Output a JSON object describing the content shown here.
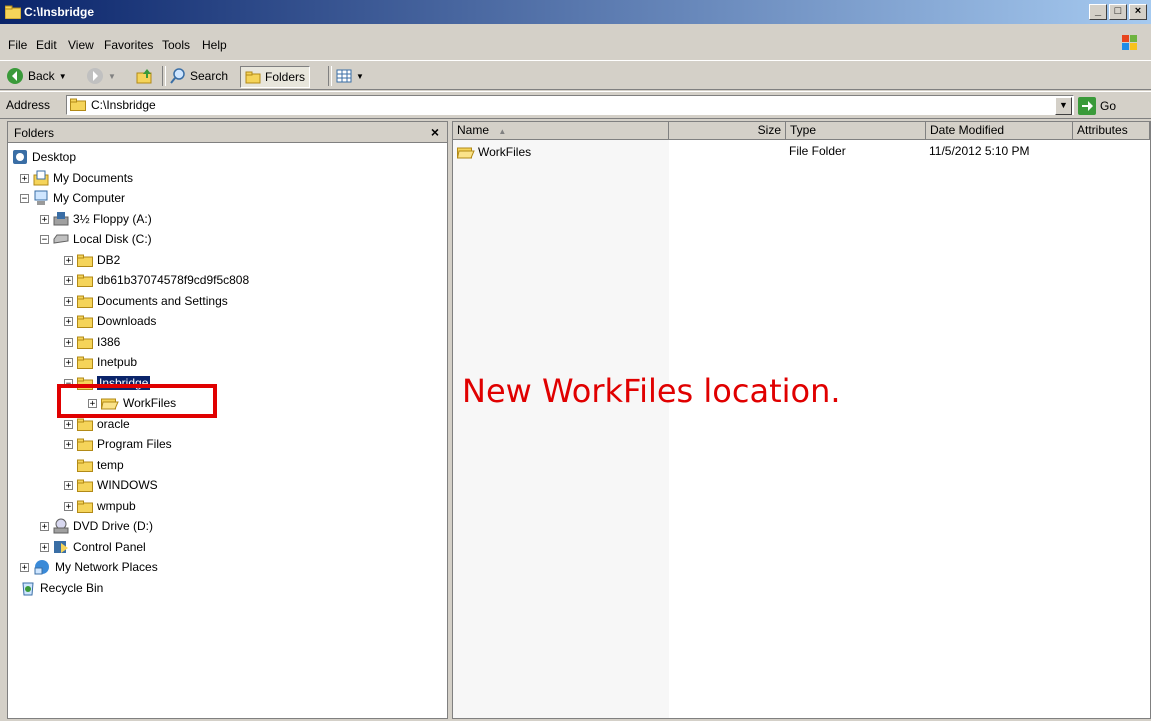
{
  "window": {
    "title": "C:\\Insbridge"
  },
  "menu": [
    {
      "label": "File"
    },
    {
      "label": "Edit"
    },
    {
      "label": "View"
    },
    {
      "label": "Favorites"
    },
    {
      "label": "Tools"
    },
    {
      "label": "Help"
    }
  ],
  "toolbar": {
    "back": "Back",
    "search": "Search",
    "folders": "Folders"
  },
  "address": {
    "label": "Address",
    "value": "C:\\Insbridge",
    "go": "Go"
  },
  "folder_pane": {
    "title": "Folders",
    "close": "×",
    "tree": [
      {
        "label": "Desktop"
      },
      {
        "label": "My Documents"
      },
      {
        "label": "My Computer"
      },
      {
        "label": "3½ Floppy (A:)"
      },
      {
        "label": "Local Disk (C:)"
      },
      {
        "label": "DB2"
      },
      {
        "label": "db61b37074578f9cd9f5c808"
      },
      {
        "label": "Documents and Settings"
      },
      {
        "label": "Downloads"
      },
      {
        "label": "I386"
      },
      {
        "label": "Inetpub"
      },
      {
        "label": "Insbridge"
      },
      {
        "label": "WorkFiles"
      },
      {
        "label": "oracle"
      },
      {
        "label": "Program Files"
      },
      {
        "label": "temp"
      },
      {
        "label": "WINDOWS"
      },
      {
        "label": "wmpub"
      },
      {
        "label": "DVD Drive (D:)"
      },
      {
        "label": "Control Panel"
      },
      {
        "label": "My Network Places"
      },
      {
        "label": "Recycle Bin"
      }
    ]
  },
  "file_list": {
    "columns": [
      "Name",
      "Size",
      "Type",
      "Date Modified",
      "Attributes"
    ],
    "sort_indicator": "▲",
    "rows": [
      {
        "name": "WorkFiles",
        "size": "",
        "type": "File Folder",
        "date": "11/5/2012 5:10 PM",
        "attributes": ""
      }
    ]
  },
  "annotation": {
    "text": "New WorkFiles location.",
    "color": "#e00000"
  }
}
